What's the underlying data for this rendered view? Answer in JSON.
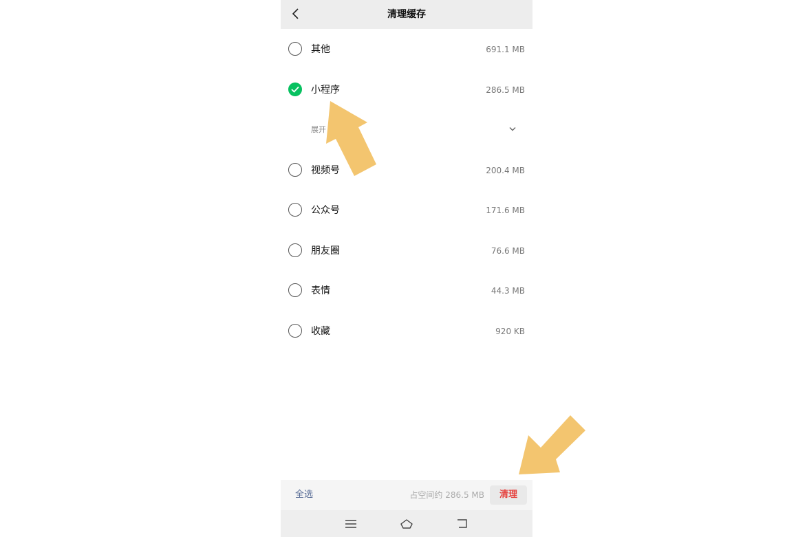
{
  "header": {
    "title": "清理缓存",
    "back_icon": "chevron-left-icon"
  },
  "items": [
    {
      "label": "其他",
      "size": "691.1 MB",
      "checked": false
    },
    {
      "label": "小程序",
      "size": "286.5 MB",
      "checked": true
    },
    {
      "label": "视频号",
      "size": "200.4 MB",
      "checked": false
    },
    {
      "label": "公众号",
      "size": "171.6 MB",
      "checked": false
    },
    {
      "label": "朋友圈",
      "size": "76.6 MB",
      "checked": false
    },
    {
      "label": "表情",
      "size": "44.3 MB",
      "checked": false
    },
    {
      "label": "收藏",
      "size": "920 KB",
      "checked": false
    }
  ],
  "expand": {
    "label": "展开",
    "icon": "chevron-down-icon"
  },
  "footer": {
    "select_all": "全选",
    "space_info": "占空间约 286.5 MB",
    "clean_label": "清理"
  },
  "colors": {
    "accent_green": "#07c160",
    "danger_red": "#e64340",
    "link_blue": "#576b95",
    "arrow": "#f3c56f"
  },
  "nav_icons": [
    "menu-icon",
    "home-icon",
    "back-icon"
  ]
}
